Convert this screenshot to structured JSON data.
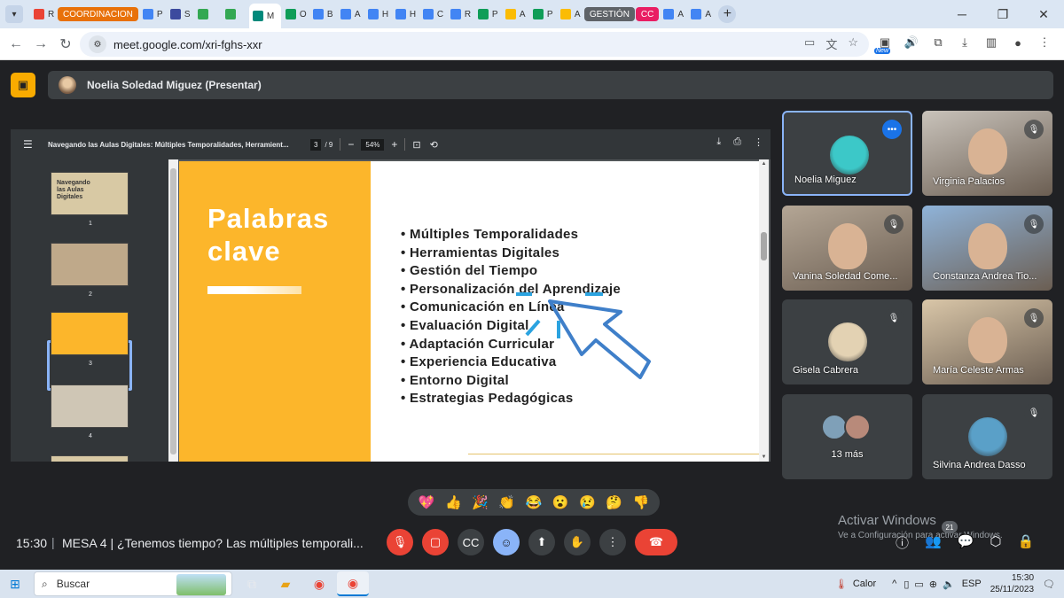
{
  "browser": {
    "tabs": [
      {
        "label": "R",
        "color": "#ea4335"
      },
      {
        "label": "COORDINACION",
        "color": "#e8710a",
        "badge": true
      },
      {
        "label": "P",
        "color": "#4285f4"
      },
      {
        "label": "S",
        "color": "#3c4a9e"
      },
      {
        "label": "",
        "color": "#34a853"
      },
      {
        "label": "",
        "color": "#34a853"
      },
      {
        "label": "M",
        "color": "#00897b",
        "active": true
      },
      {
        "label": "O",
        "color": "#0f9d58"
      },
      {
        "label": "B",
        "color": "#4285f4"
      },
      {
        "label": "A",
        "color": "#4285f4"
      },
      {
        "label": "H",
        "color": "#4285f4"
      },
      {
        "label": "H",
        "color": "#4285f4"
      },
      {
        "label": "C",
        "color": "#4285f4"
      },
      {
        "label": "R",
        "color": "#4285f4"
      },
      {
        "label": "P",
        "color": "#0f9d58"
      },
      {
        "label": "A",
        "color": "#fbbc04"
      },
      {
        "label": "P",
        "color": "#0f9d58"
      },
      {
        "label": "A",
        "color": "#fbbc04"
      },
      {
        "label": "GESTIÓN",
        "color": "#5f6368",
        "badge": true
      },
      {
        "label": "CC",
        "color": "#e91e63",
        "badge": true
      },
      {
        "label": "A",
        "color": "#4285f4"
      },
      {
        "label": "A",
        "color": "#4285f4"
      }
    ],
    "url": "meet.google.com/xri-fghs-xxr",
    "new_badge": "New"
  },
  "presentation_bar": {
    "presenter": "Noelia Soledad Miguez (Presentar)"
  },
  "pdf": {
    "title": "Navegando las Aulas Digitales: Múltiples Temporalidades, Herramient...",
    "page": "3",
    "total": "/ 9",
    "zoom": "54%",
    "thumbnails": [
      {
        "num": "1",
        "bg": "#d8c9a4",
        "text": "Navegando las Aulas Digitales"
      },
      {
        "num": "2",
        "bg": "#bfa98a",
        "text": ""
      },
      {
        "num": "3",
        "bg": "#fcb62b",
        "text": ""
      },
      {
        "num": "4",
        "bg": "#cfc6b5",
        "text": ""
      }
    ],
    "slide": {
      "title_line1": "Palabras",
      "title_line2": "clave",
      "bullets": [
        "Múltiples Temporalidades",
        "Herramientas Digitales",
        "Gestión del Tiempo",
        "Personalización del Aprendizaje",
        "Comunicación en Línea",
        "Evaluación Digital",
        "Adaptación Curricular",
        "Experiencia Educativa",
        "Entorno Digital",
        "Estrategias Pedagógicas"
      ]
    }
  },
  "participants": [
    {
      "name": "Noelia Miguez",
      "type": "avatar",
      "color": "#3cc8c8"
    },
    {
      "name": "Virginia Palacios",
      "type": "video",
      "color": "#c9c3bb"
    },
    {
      "name": "Vanina Soledad Come...",
      "type": "video",
      "color": "#b4a695"
    },
    {
      "name": "Constanza Andrea Tio...",
      "type": "video",
      "color": "#8fb3d9"
    },
    {
      "name": "Gisela Cabrera",
      "type": "avatar",
      "color": "#e3d2b3"
    },
    {
      "name": "María Celeste Armas",
      "type": "video",
      "color": "#d9c6a8"
    },
    {
      "name": "13 más",
      "type": "group",
      "color": "#3c4043"
    },
    {
      "name": "Silvina Andrea Dasso",
      "type": "avatar",
      "color": "#5aa0c8"
    }
  ],
  "reactions": [
    "💖",
    "👍",
    "🎉",
    "👏",
    "😂",
    "😮",
    "😢",
    "🤔",
    "👎"
  ],
  "meeting": {
    "time": "15:30",
    "separator": "|",
    "title": "MESA 4 | ¿Tenemos tiempo? Las múltiples temporali...",
    "participant_count": "21"
  },
  "watermark": {
    "title": "Activar Windows",
    "subtitle": "Ve a Configuración para activar Windows."
  },
  "taskbar": {
    "search": "Buscar",
    "weather": "Calor",
    "lang": "ESP",
    "time": "15:30",
    "date": "25/11/2023"
  }
}
